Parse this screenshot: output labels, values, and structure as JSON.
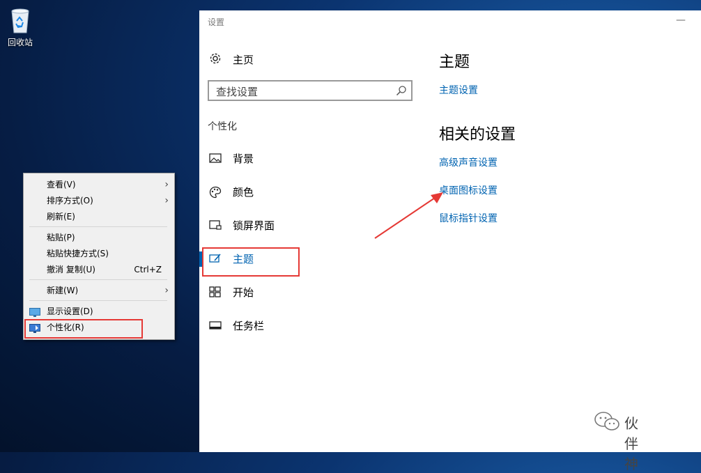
{
  "desktop": {
    "recycle_bin_label": "回收站"
  },
  "context_menu": {
    "items": [
      {
        "label": "查看(V)",
        "submenu": true
      },
      {
        "label": "排序方式(O)",
        "submenu": true
      },
      {
        "label": "刷新(E)"
      },
      {
        "label": "粘贴(P)"
      },
      {
        "label": "粘贴快捷方式(S)"
      },
      {
        "label": "撤消 复制(U)",
        "shortcut": "Ctrl+Z"
      },
      {
        "label": "新建(W)",
        "submenu": true
      },
      {
        "label": "显示设置(D)",
        "icon": "display-icon"
      },
      {
        "label": "个性化(R)",
        "icon": "personalize-icon"
      }
    ]
  },
  "settings": {
    "window_title": "设置",
    "minimize": "—",
    "home_label": "主页",
    "search_placeholder": "查找设置",
    "section_header": "个性化",
    "nav": [
      {
        "label": "背景",
        "icon": "picture-icon"
      },
      {
        "label": "颜色",
        "icon": "palette-icon"
      },
      {
        "label": "锁屏界面",
        "icon": "lockscreen-icon"
      },
      {
        "label": "主题",
        "icon": "theme-brush-icon",
        "active": true
      },
      {
        "label": "开始",
        "icon": "start-grid-icon"
      },
      {
        "label": "任务栏",
        "icon": "taskbar-icon"
      }
    ],
    "content": {
      "heading": "主题",
      "theme_settings_link": "主题设置",
      "related_heading": "相关的设置",
      "related_links": [
        "高级声音设置",
        "桌面图标设置",
        "鼠标指针设置"
      ]
    },
    "accent_color": "#0063b1"
  },
  "watermark": {
    "text": "伙伴神"
  },
  "annotation_color": "#e53935"
}
